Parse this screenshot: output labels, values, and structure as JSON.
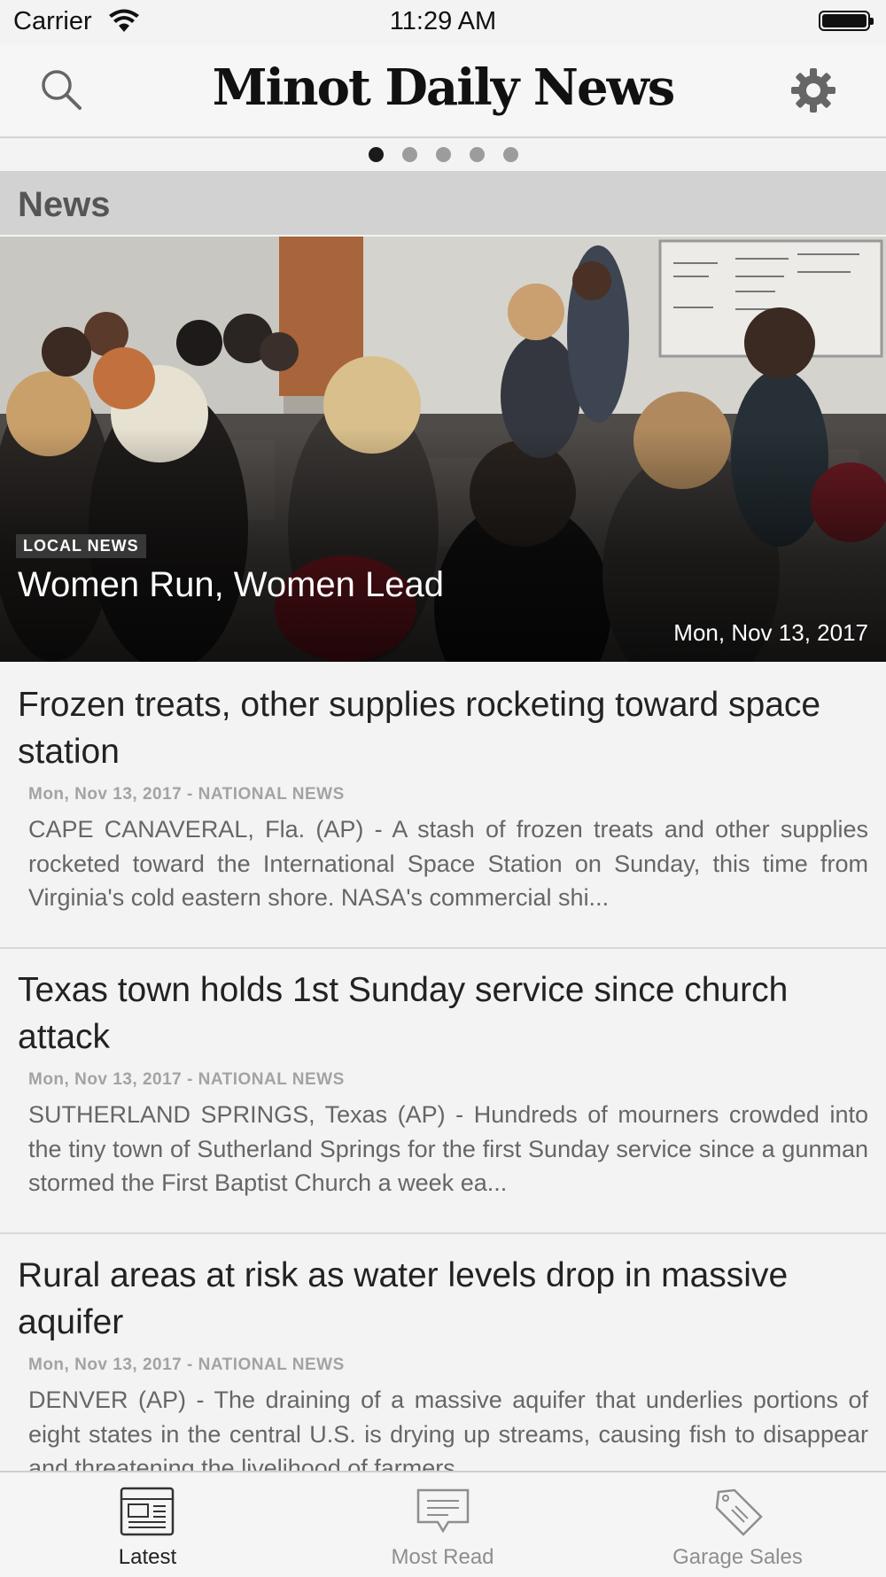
{
  "status_bar": {
    "carrier": "Carrier",
    "time": "11:29 AM"
  },
  "header": {
    "brand": "Minot Daily News",
    "search_icon": "search-icon",
    "settings_icon": "gear-icon"
  },
  "pager": {
    "count": 5,
    "active_index": 0
  },
  "section": {
    "title": "News"
  },
  "hero": {
    "category": "LOCAL NEWS",
    "title": "Women Run, Women Lead",
    "date": "Mon, Nov 13, 2017"
  },
  "articles": [
    {
      "title": "Frozen treats, other supplies rocketing toward space station",
      "meta": "Mon, Nov 13, 2017 - NATIONAL NEWS",
      "body": "CAPE CANAVERAL, Fla. (AP) - A stash of frozen treats and other supplies rocketed toward the International Space Station on Sunday, this time from Virginia's cold eastern shore. NASA's commercial shi..."
    },
    {
      "title": "Texas town holds 1st Sunday service since church attack",
      "meta": "Mon, Nov 13, 2017 - NATIONAL NEWS",
      "body": "SUTHERLAND SPRINGS, Texas (AP) - Hundreds of mourners crowded into the tiny town of Sutherland Springs for the first Sunday service since a gunman stormed the First Baptist Church a week ea..."
    },
    {
      "title": "Rural areas at risk as water levels drop in massive aquifer",
      "meta": "Mon, Nov 13, 2017 - NATIONAL NEWS",
      "body": "DENVER (AP) - The draining of a massive aquifer that underlies portions of eight states in the central U.S. is drying up streams, causing fish to disappear and threatening the livelihood of farmers..."
    }
  ],
  "tabs": [
    {
      "label": "Latest",
      "icon": "newspaper-icon",
      "active": true
    },
    {
      "label": "Most Read",
      "icon": "message-icon",
      "active": false
    },
    {
      "label": "Garage Sales",
      "icon": "sale-tag-icon",
      "active": false
    }
  ],
  "colors": {
    "section_bg": "#d2d2d2",
    "active_dot": "#1a1a1a",
    "inactive_dot": "#9c9c9c",
    "active_tab": "#222222",
    "inactive_tab": "#8e8e8e"
  }
}
